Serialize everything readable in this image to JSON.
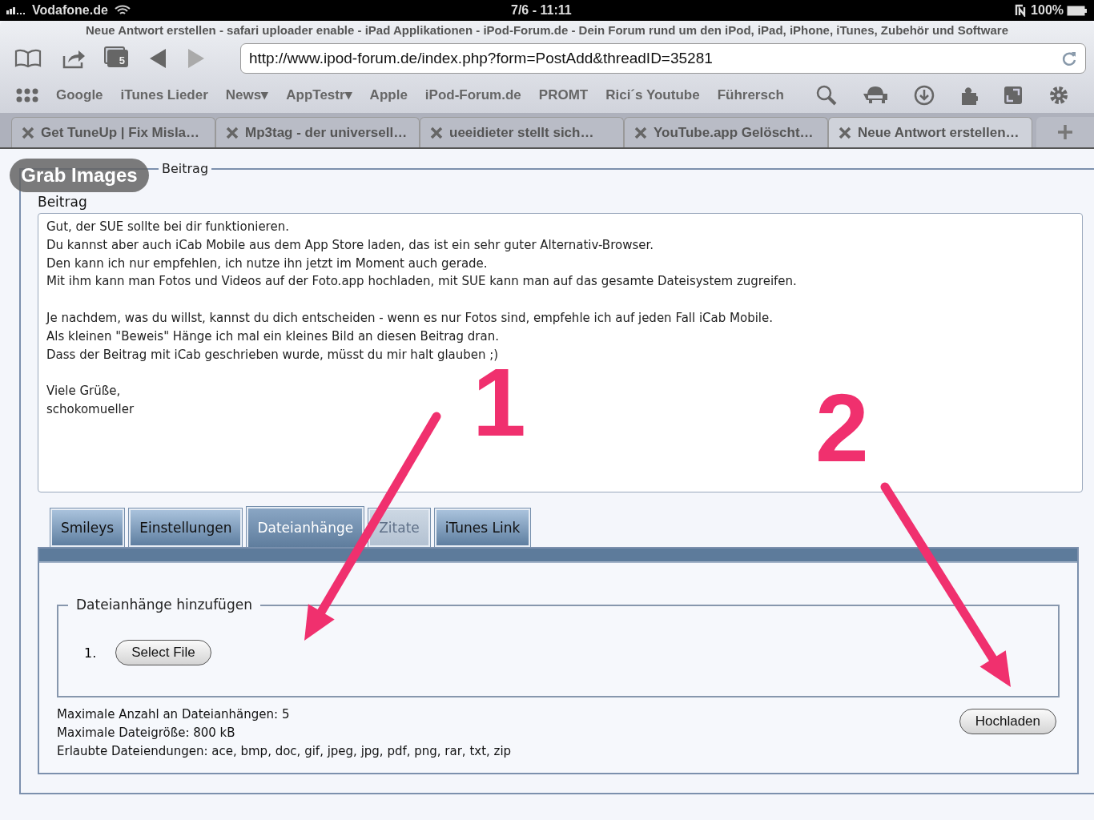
{
  "status_bar": {
    "carrier": "Vodafone.de",
    "time": "7/6 - 11:11",
    "battery": "100%"
  },
  "browser": {
    "page_title": "Neue Antwort erstellen - safari uploader enable - iPad Applikationen - iPod-Forum.de - Dein Forum rund um den iPod, iPad, iPhone, iTunes, Zubehör und Software",
    "tab_count": "5",
    "url": "http://www.ipod-forum.de/index.php?form=PostAdd&threadID=35281",
    "bookmarks": [
      {
        "label": "Google"
      },
      {
        "label": "iTunes Lieder"
      },
      {
        "label": "News▾"
      },
      {
        "label": "AppTestr▾"
      },
      {
        "label": "Apple"
      },
      {
        "label": "iPod-Forum.de"
      },
      {
        "label": "PROMT"
      },
      {
        "label": "Rici´s Youtube"
      },
      {
        "label": "Führersch"
      }
    ],
    "tabs": [
      {
        "title": "Get TuneUp | Fix Misla…",
        "selected": false
      },
      {
        "title": "Mp3tag - der universell…",
        "selected": false
      },
      {
        "title": "ueeidieter stellt sich…",
        "selected": false
      },
      {
        "title": "YouTube.app Gelöscht…",
        "selected": false
      },
      {
        "title": "Neue Antwort erstellen…",
        "selected": true
      }
    ]
  },
  "grab_images_button": "Grab Images",
  "form": {
    "legend": "Beitrag",
    "label": "Beitrag",
    "body": "Gut, der SUE sollte bei dir funktionieren.\nDu kannst aber auch iCab Mobile aus dem App Store laden, das ist ein sehr guter Alternativ-Browser.\nDen kann ich nur empfehlen, ich nutze ihn jetzt im Moment auch gerade.\nMit ihm kann man Fotos und Videos auf der Foto.app hochladen, mit SUE kann man auf das gesamte Dateisystem zugreifen.\n\nJe nachdem, was du willst, kannst du dich entscheiden - wenn es nur Fotos sind, empfehle ich auf jeden Fall iCab Mobile.\nAls kleinen \"Beweis\" Hänge ich mal ein kleines Bild an diesen Beitrag dran.\nDass der Beitrag mit iCab geschrieben wurde, müsst du mir halt glauben ;)\n\nViele Grüße,\nschokomueller",
    "tabs": [
      {
        "label": "Smileys",
        "selected": false,
        "disabled": false
      },
      {
        "label": "Einstellungen",
        "selected": false,
        "disabled": false
      },
      {
        "label": "Dateianhänge",
        "selected": true,
        "disabled": false
      },
      {
        "label": "Zitate",
        "selected": false,
        "disabled": true
      },
      {
        "label": "iTunes Link",
        "selected": false,
        "disabled": false
      }
    ],
    "attachments": {
      "legend": "Dateianhänge hinzufügen",
      "items": [
        {
          "number": "1.",
          "button": "Select File"
        }
      ],
      "info": [
        "Maximale Anzahl an Dateianhängen: 5",
        "Maximale Dateigröße: 800 kB",
        "Erlaubte Dateiendungen: ace, bmp, doc, gif, jpeg, jpg, pdf, png, rar, txt, zip"
      ],
      "upload_button": "Hochladen"
    }
  },
  "annotations": [
    {
      "number": "1"
    },
    {
      "number": "2"
    }
  ]
}
